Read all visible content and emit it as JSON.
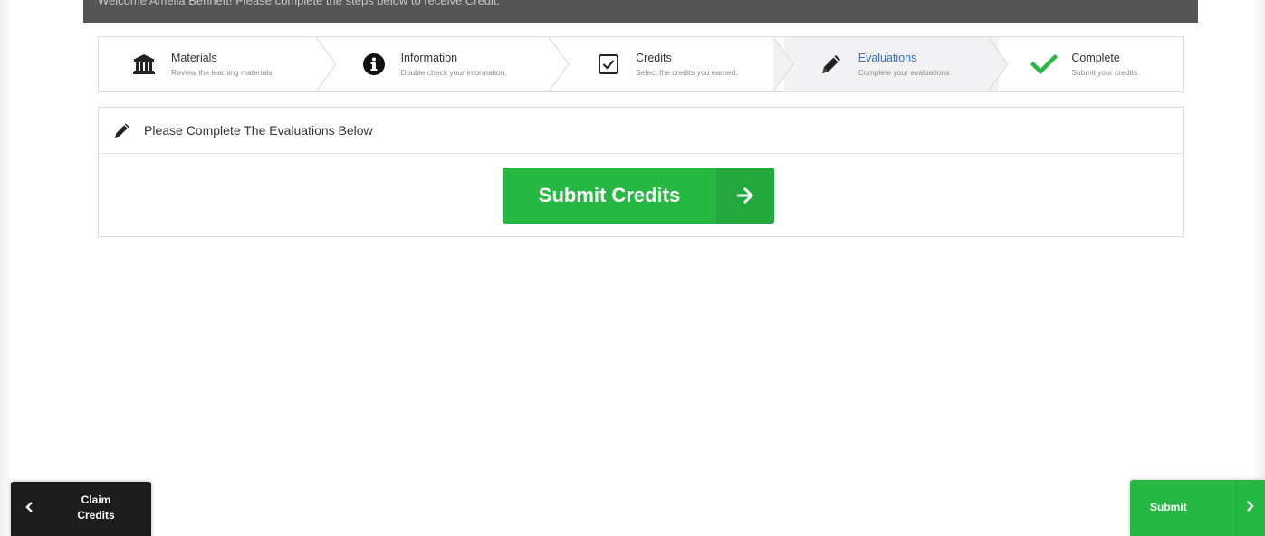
{
  "header": {
    "welcome_text": "Welcome Amelia Bennett! Please complete the steps below to receive Credit."
  },
  "steps": [
    {
      "title": "Materials",
      "subtitle": "Review the learning materials.",
      "icon": "bank-icon",
      "active": false
    },
    {
      "title": "Information",
      "subtitle": "Double check your information.",
      "icon": "info-circle-icon",
      "active": false
    },
    {
      "title": "Credits",
      "subtitle": "Select the credits you earned.",
      "icon": "checkbox-icon",
      "active": false
    },
    {
      "title": "Evaluations",
      "subtitle": "Complete your evaluations.",
      "icon": "pencil-icon",
      "active": true
    },
    {
      "title": "Complete",
      "subtitle": "Submit your credits.",
      "icon": "checkmark-icon",
      "active": false
    }
  ],
  "panel": {
    "title": "Please Complete The Evaluations Below",
    "icon": "pencil-icon",
    "submit_credits_label": "Submit Credits",
    "submit_credits_icon": "arrow-right-icon"
  },
  "footer": {
    "claim_label_line1": "Claim",
    "claim_label_line2": "Credits",
    "claim_icon": "chevron-left-icon",
    "submit_label": "Submit",
    "submit_icon": "chevron-right-icon"
  },
  "colors": {
    "accent_green": "#27b844",
    "active_step_text": "#2f6fb6",
    "topbar": "#555555",
    "dark_button": "#1c1c1c"
  }
}
